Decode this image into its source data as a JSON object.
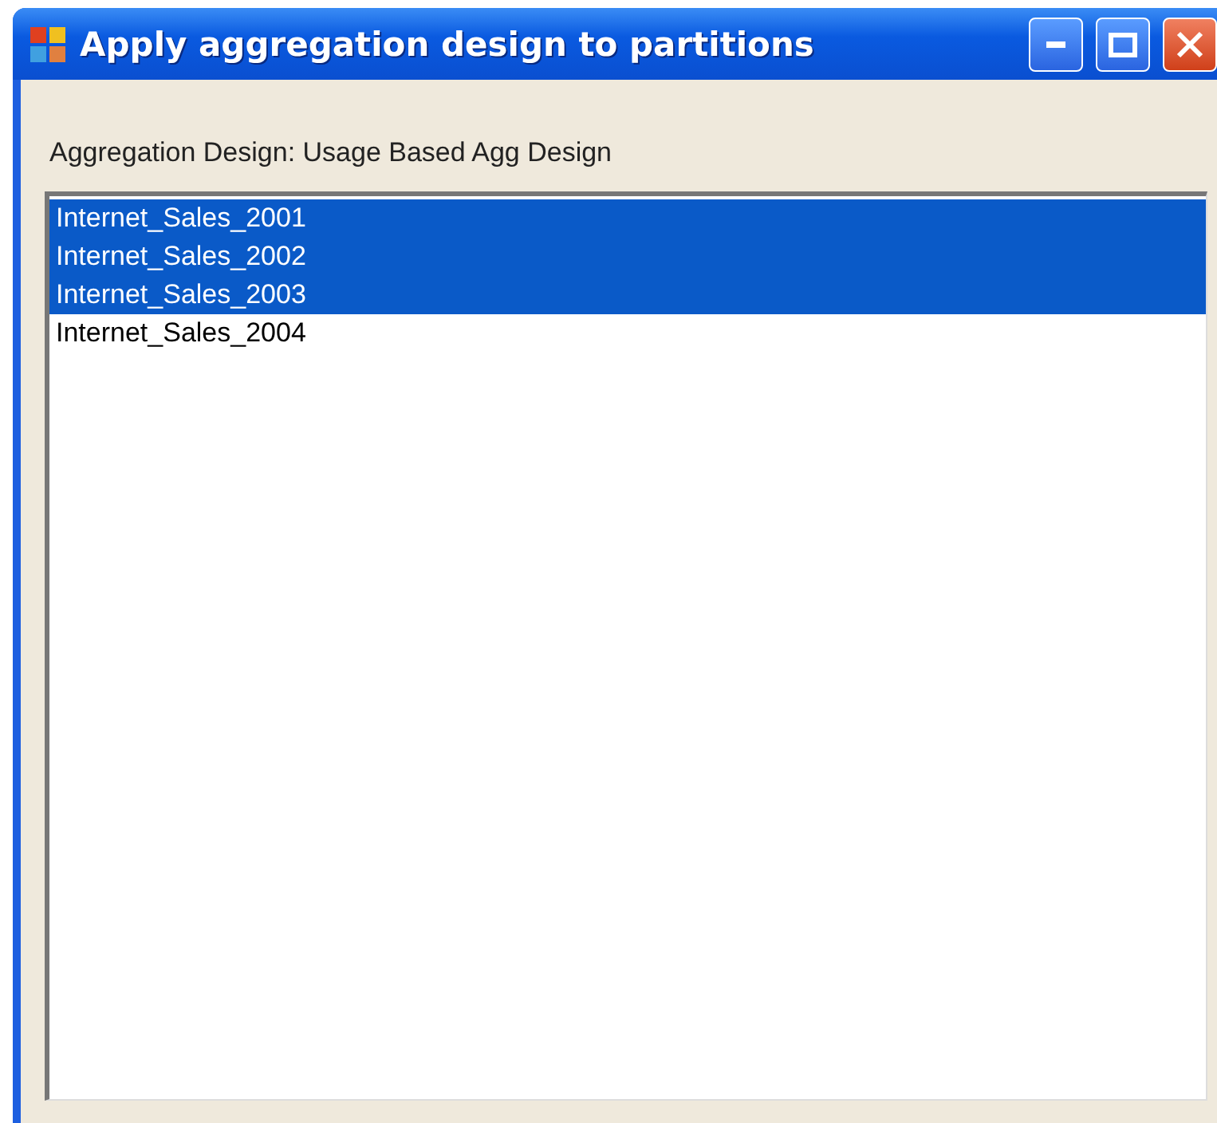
{
  "window": {
    "title": "Apply aggregation design to partitions"
  },
  "label": "Aggregation Design: Usage Based Agg Design",
  "partitions": [
    {
      "name": "Internet_Sales_2001",
      "selected": true
    },
    {
      "name": "Internet_Sales_2002",
      "selected": true
    },
    {
      "name": "Internet_Sales_2003",
      "selected": true
    },
    {
      "name": "Internet_Sales_2004",
      "selected": false
    }
  ]
}
